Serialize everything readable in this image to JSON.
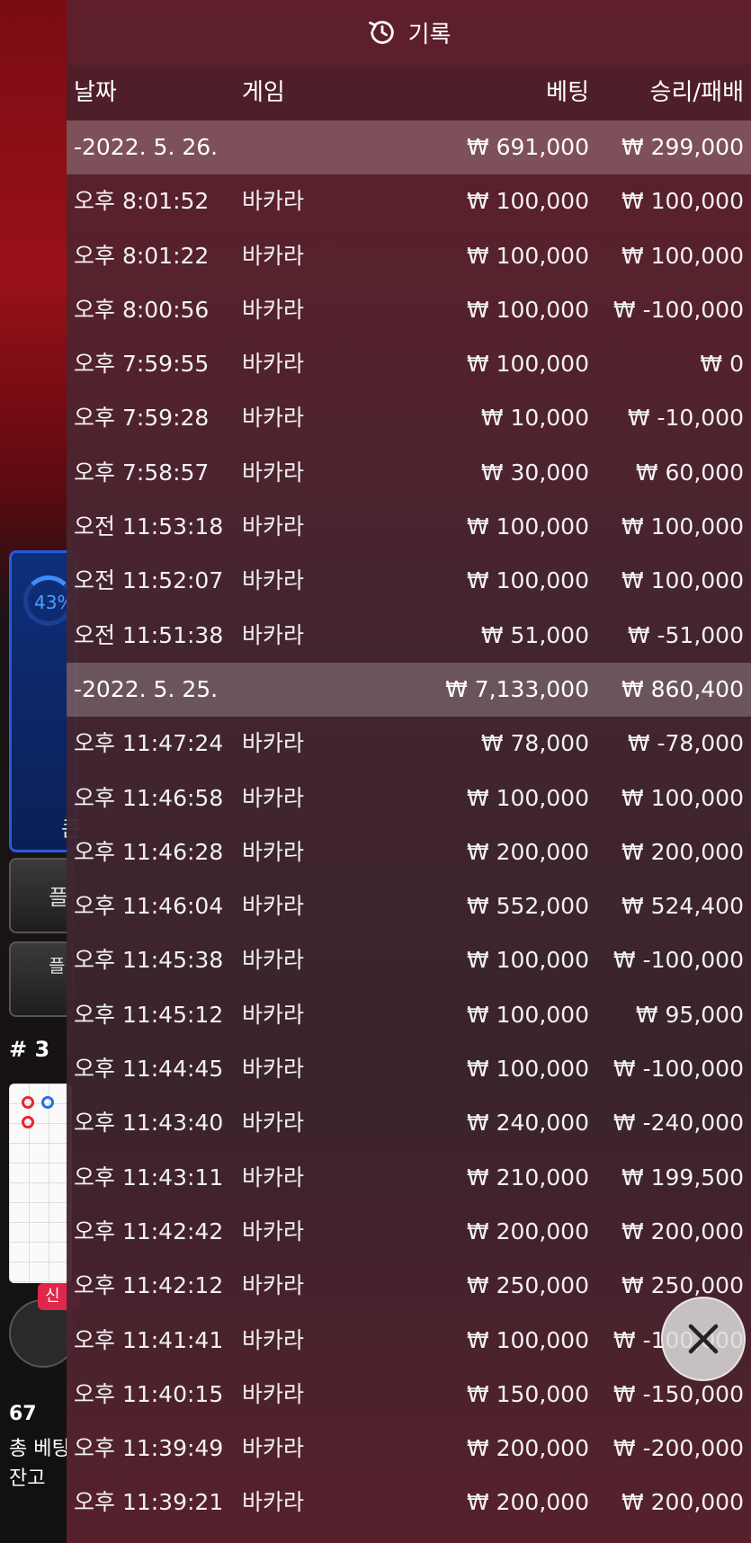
{
  "background": {
    "stats_percent": "43%",
    "stats_label": "큰",
    "button_1_label": "플",
    "button_2_label": "플",
    "table_number": "# 3",
    "new_badge": "신",
    "players_count": "67",
    "total_bet_label": "총 베팅",
    "balance_label": "잔고"
  },
  "header": {
    "title": "기록",
    "columns": {
      "date": "날짜",
      "game": "게임",
      "bet": "베팅",
      "result": "승리/패배"
    }
  },
  "rows": [
    {
      "type": "date",
      "date": "-2022. 5. 26.",
      "game": "",
      "bet": "₩ 691,000",
      "result": "₩ 299,000"
    },
    {
      "type": "entry",
      "date": "오후 8:01:52",
      "game": "바카라",
      "bet": "₩ 100,000",
      "result": "₩ 100,000"
    },
    {
      "type": "entry",
      "date": "오후 8:01:22",
      "game": "바카라",
      "bet": "₩ 100,000",
      "result": "₩ 100,000"
    },
    {
      "type": "entry",
      "date": "오후 8:00:56",
      "game": "바카라",
      "bet": "₩ 100,000",
      "result": "₩ -100,000"
    },
    {
      "type": "entry",
      "date": "오후 7:59:55",
      "game": "바카라",
      "bet": "₩ 100,000",
      "result": "₩ 0"
    },
    {
      "type": "entry",
      "date": "오후 7:59:28",
      "game": "바카라",
      "bet": "₩ 10,000",
      "result": "₩ -10,000"
    },
    {
      "type": "entry",
      "date": "오후 7:58:57",
      "game": "바카라",
      "bet": "₩ 30,000",
      "result": "₩ 60,000"
    },
    {
      "type": "entry",
      "date": "오전 11:53:18",
      "game": "바카라",
      "bet": "₩ 100,000",
      "result": "₩ 100,000"
    },
    {
      "type": "entry",
      "date": "오전 11:52:07",
      "game": "바카라",
      "bet": "₩ 100,000",
      "result": "₩ 100,000"
    },
    {
      "type": "entry",
      "date": "오전 11:51:38",
      "game": "바카라",
      "bet": "₩ 51,000",
      "result": "₩ -51,000"
    },
    {
      "type": "date",
      "date": "-2022. 5. 25.",
      "game": "",
      "bet": "₩ 7,133,000",
      "result": "₩ 860,400"
    },
    {
      "type": "entry",
      "date": "오후 11:47:24",
      "game": "바카라",
      "bet": "₩ 78,000",
      "result": "₩ -78,000"
    },
    {
      "type": "entry",
      "date": "오후 11:46:58",
      "game": "바카라",
      "bet": "₩ 100,000",
      "result": "₩ 100,000"
    },
    {
      "type": "entry",
      "date": "오후 11:46:28",
      "game": "바카라",
      "bet": "₩ 200,000",
      "result": "₩ 200,000"
    },
    {
      "type": "entry",
      "date": "오후 11:46:04",
      "game": "바카라",
      "bet": "₩ 552,000",
      "result": "₩ 524,400"
    },
    {
      "type": "entry",
      "date": "오후 11:45:38",
      "game": "바카라",
      "bet": "₩ 100,000",
      "result": "₩ -100,000"
    },
    {
      "type": "entry",
      "date": "오후 11:45:12",
      "game": "바카라",
      "bet": "₩ 100,000",
      "result": "₩ 95,000"
    },
    {
      "type": "entry",
      "date": "오후 11:44:45",
      "game": "바카라",
      "bet": "₩ 100,000",
      "result": "₩ -100,000"
    },
    {
      "type": "entry",
      "date": "오후 11:43:40",
      "game": "바카라",
      "bet": "₩ 240,000",
      "result": "₩ -240,000"
    },
    {
      "type": "entry",
      "date": "오후 11:43:11",
      "game": "바카라",
      "bet": "₩ 210,000",
      "result": "₩ 199,500"
    },
    {
      "type": "entry",
      "date": "오후 11:42:42",
      "game": "바카라",
      "bet": "₩ 200,000",
      "result": "₩ 200,000"
    },
    {
      "type": "entry",
      "date": "오후 11:42:12",
      "game": "바카라",
      "bet": "₩ 250,000",
      "result": "₩ 250,000"
    },
    {
      "type": "entry",
      "date": "오후 11:41:41",
      "game": "바카라",
      "bet": "₩ 100,000",
      "result": "₩ -100,000"
    },
    {
      "type": "entry",
      "date": "오후 11:40:15",
      "game": "바카라",
      "bet": "₩ 150,000",
      "result": "₩ -150,000"
    },
    {
      "type": "entry",
      "date": "오후 11:39:49",
      "game": "바카라",
      "bet": "₩ 200,000",
      "result": "₩ -200,000"
    },
    {
      "type": "entry",
      "date": "오후 11:39:21",
      "game": "바카라",
      "bet": "₩ 200,000",
      "result": "₩ 200,000"
    }
  ],
  "close_icon": "close-icon",
  "history_icon": "history-icon",
  "colors": {
    "panel": "#5c2030",
    "date_row": "#7a5a62",
    "stats_blue": "#2a5ad8",
    "badge_red": "#e0264a"
  }
}
